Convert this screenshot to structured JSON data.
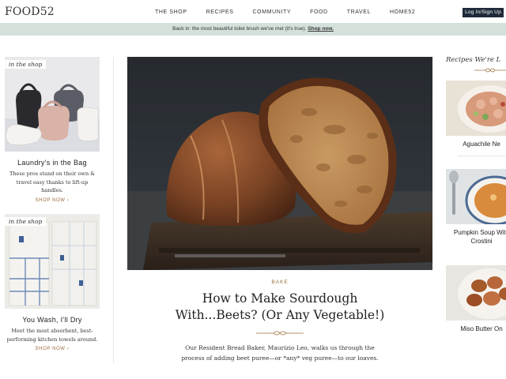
{
  "header": {
    "logo": "FOOD52",
    "nav": [
      "THE SHOP",
      "RECIPES",
      "COMMUNITY",
      "FOOD",
      "TRAVEL",
      "HOME52"
    ],
    "login_label": "Log In/Sign Up"
  },
  "banner": {
    "text": "Back in: the most beautiful toilet brush we've met (it's true). ",
    "link": "Shop now."
  },
  "left_cards": [
    {
      "tag": "in the shop",
      "title": "Laundry's in the Bag",
      "description": "These pros stand on their own & travel easy thanks to lift-up handles.",
      "cta": "SHOP NOW ›"
    },
    {
      "tag": "in the shop",
      "title": "You Wash, I'll Dry",
      "description": "Meet the most absorbent, best-performing kitchen towels around.",
      "cta": "SHOP NOW ›"
    }
  ],
  "hero": {
    "category": "BAKE",
    "title_line1": "How to Make Sourdough",
    "title_line2": "With...Beets? (Or Any Vegetable!)",
    "desc_line1": "Our Resident Bread Baker, Maurizio Leo, walks us through the",
    "desc_line2": "process of adding beet puree—or *any* veg puree—to our loaves."
  },
  "right": {
    "heading": "Recipes We're L",
    "items": [
      {
        "title": "Aguachile Ne"
      },
      {
        "title_line1": "Pumpkin Soup With",
        "title_line2": "Crostini"
      },
      {
        "title": "Miso Butter On"
      }
    ]
  },
  "colors": {
    "banner_bg": "#d4e1db",
    "login_bg": "#1e2a3a",
    "accent_brown": "#9a6b3a"
  }
}
